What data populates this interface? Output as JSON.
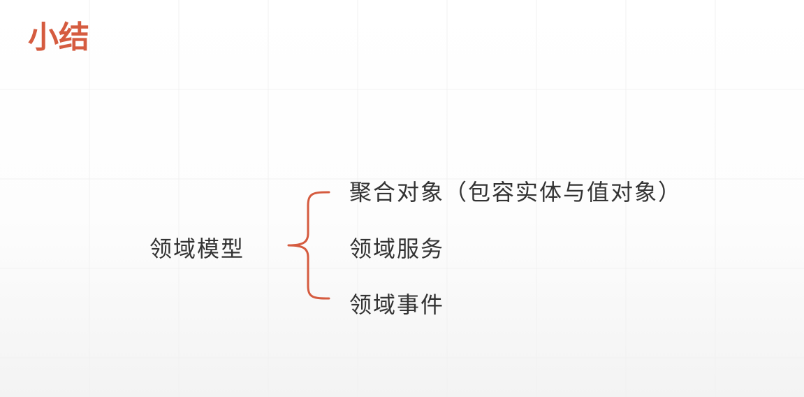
{
  "slide": {
    "title": "小结",
    "accent_color": "#d55b3f"
  },
  "diagram": {
    "root": "领域模型",
    "branches": [
      "聚合对象（包容实体与值对象）",
      "领域服务",
      "领域事件"
    ],
    "connector_color": "#d55b3f"
  }
}
